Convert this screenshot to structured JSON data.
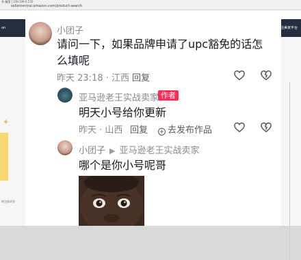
{
  "background": {
    "tab_text": "多·美国 | 139.199.6.235",
    "address_bar": "sellercentral.amazon.com/product-search",
    "header_left": "on",
    "header_right": "注美家平台",
    "sidebar_label": "地注册消息"
  },
  "comments": [
    {
      "username": "小团子",
      "text": "请问一下，如果品牌申请了upc豁免的话怎么填呢",
      "meta": "昨天 23:18 · 江西",
      "reply_label": "回复"
    },
    {
      "username": "亚马逊老王实战卖家",
      "badge": "作者",
      "text": "明天小号给你更新",
      "meta": "昨天 · 山西",
      "reply_label": "回复",
      "share_label": "去发布作品"
    },
    {
      "username": "小团子",
      "reply_to": "亚马逊老王实战卖家",
      "text": "哪个是你小号呢哥"
    }
  ],
  "icons": {
    "like": "heart-outline-icon",
    "dislike": "broken-heart-icon",
    "share": "plus-circle-icon",
    "arrow": "right-triangle-icon"
  },
  "colors": {
    "author_badge": "#fe2c55",
    "muted_text": "#8a8a8a",
    "body_text": "#161823"
  }
}
